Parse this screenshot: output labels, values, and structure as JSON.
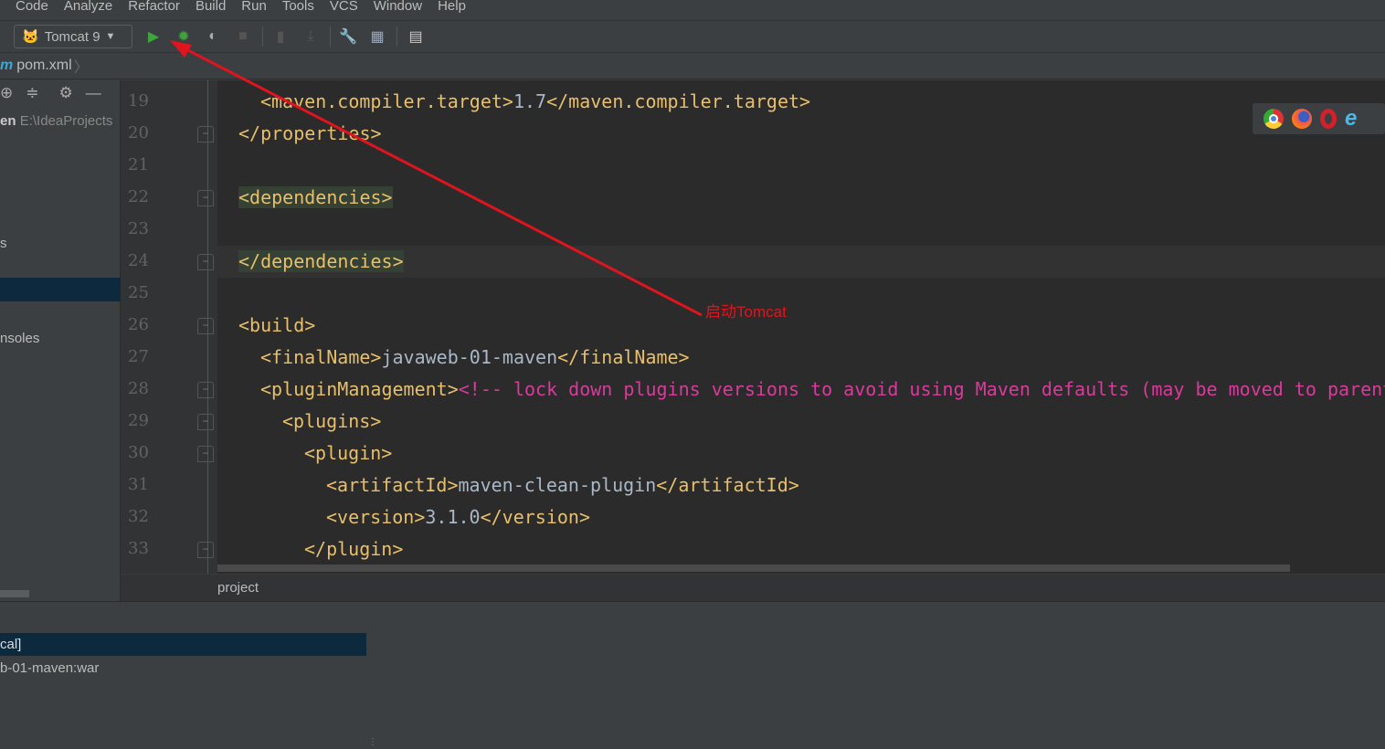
{
  "menu": [
    "Code",
    "Analyze",
    "Refactor",
    "Build",
    "Run",
    "Tools",
    "VCS",
    "Window",
    "Help"
  ],
  "toolbar": {
    "run_config": "Tomcat 9"
  },
  "navbar": {
    "file": "pom.xml",
    "file_icon": "m"
  },
  "sidebar": {
    "project_name": "en",
    "project_path": "E:\\IdeaProjects",
    "item_s": "s",
    "item_consoles": "nsoles"
  },
  "editor": {
    "lines": [
      {
        "n": "19",
        "indent": 1,
        "seg": [
          [
            "t",
            "<maven.compiler.target>"
          ],
          [
            "x",
            "1.7"
          ],
          [
            "t",
            "</maven.compiler.target>"
          ]
        ]
      },
      {
        "n": "20",
        "indent": 0,
        "seg": [
          [
            "t",
            "</properties>"
          ]
        ],
        "fold": true
      },
      {
        "n": "21",
        "indent": 0,
        "seg": []
      },
      {
        "n": "22",
        "indent": 0,
        "seg": [
          [
            "t",
            "<dependencies>"
          ]
        ],
        "fold": true,
        "hl": true
      },
      {
        "n": "23",
        "indent": 0,
        "seg": []
      },
      {
        "n": "24",
        "indent": 0,
        "seg": [
          [
            "t",
            "</dependencies>"
          ]
        ],
        "fold": true,
        "hl": true,
        "current": true
      },
      {
        "n": "25",
        "indent": 0,
        "seg": []
      },
      {
        "n": "26",
        "indent": 0,
        "seg": [
          [
            "t",
            "<build>"
          ]
        ],
        "fold": true
      },
      {
        "n": "27",
        "indent": 1,
        "seg": [
          [
            "t",
            "<finalName>"
          ],
          [
            "x",
            "javaweb-01-maven"
          ],
          [
            "t",
            "</finalName>"
          ]
        ]
      },
      {
        "n": "28",
        "indent": 1,
        "seg": [
          [
            "t",
            "<pluginManagement>"
          ],
          [
            "c",
            "<!-- lock down plugins versions to avoid using Maven defaults (may be moved to parent pom) -->"
          ]
        ],
        "fold": true
      },
      {
        "n": "29",
        "indent": 2,
        "seg": [
          [
            "t",
            "<plugins>"
          ]
        ],
        "fold": true
      },
      {
        "n": "30",
        "indent": 3,
        "seg": [
          [
            "t",
            "<plugin>"
          ]
        ],
        "fold": true
      },
      {
        "n": "31",
        "indent": 4,
        "seg": [
          [
            "t",
            "<artifactId>"
          ],
          [
            "x",
            "maven-clean-plugin"
          ],
          [
            "t",
            "</artifactId>"
          ]
        ]
      },
      {
        "n": "32",
        "indent": 4,
        "seg": [
          [
            "t",
            "<version>"
          ],
          [
            "x",
            "3.1.0"
          ],
          [
            "t",
            "</version>"
          ]
        ]
      },
      {
        "n": "33",
        "indent": 3,
        "seg": [
          [
            "t",
            "</plugin>"
          ]
        ],
        "fold": true
      }
    ],
    "breadcrumb": "project"
  },
  "annotation": {
    "label": "启动Tomcat",
    "color": "#e0141e"
  },
  "bottom": {
    "selected": "cal]",
    "item": "b-01-maven:war"
  },
  "browsers": [
    "chrome-icon",
    "firefox-icon",
    "opera-icon",
    "ie-icon"
  ]
}
